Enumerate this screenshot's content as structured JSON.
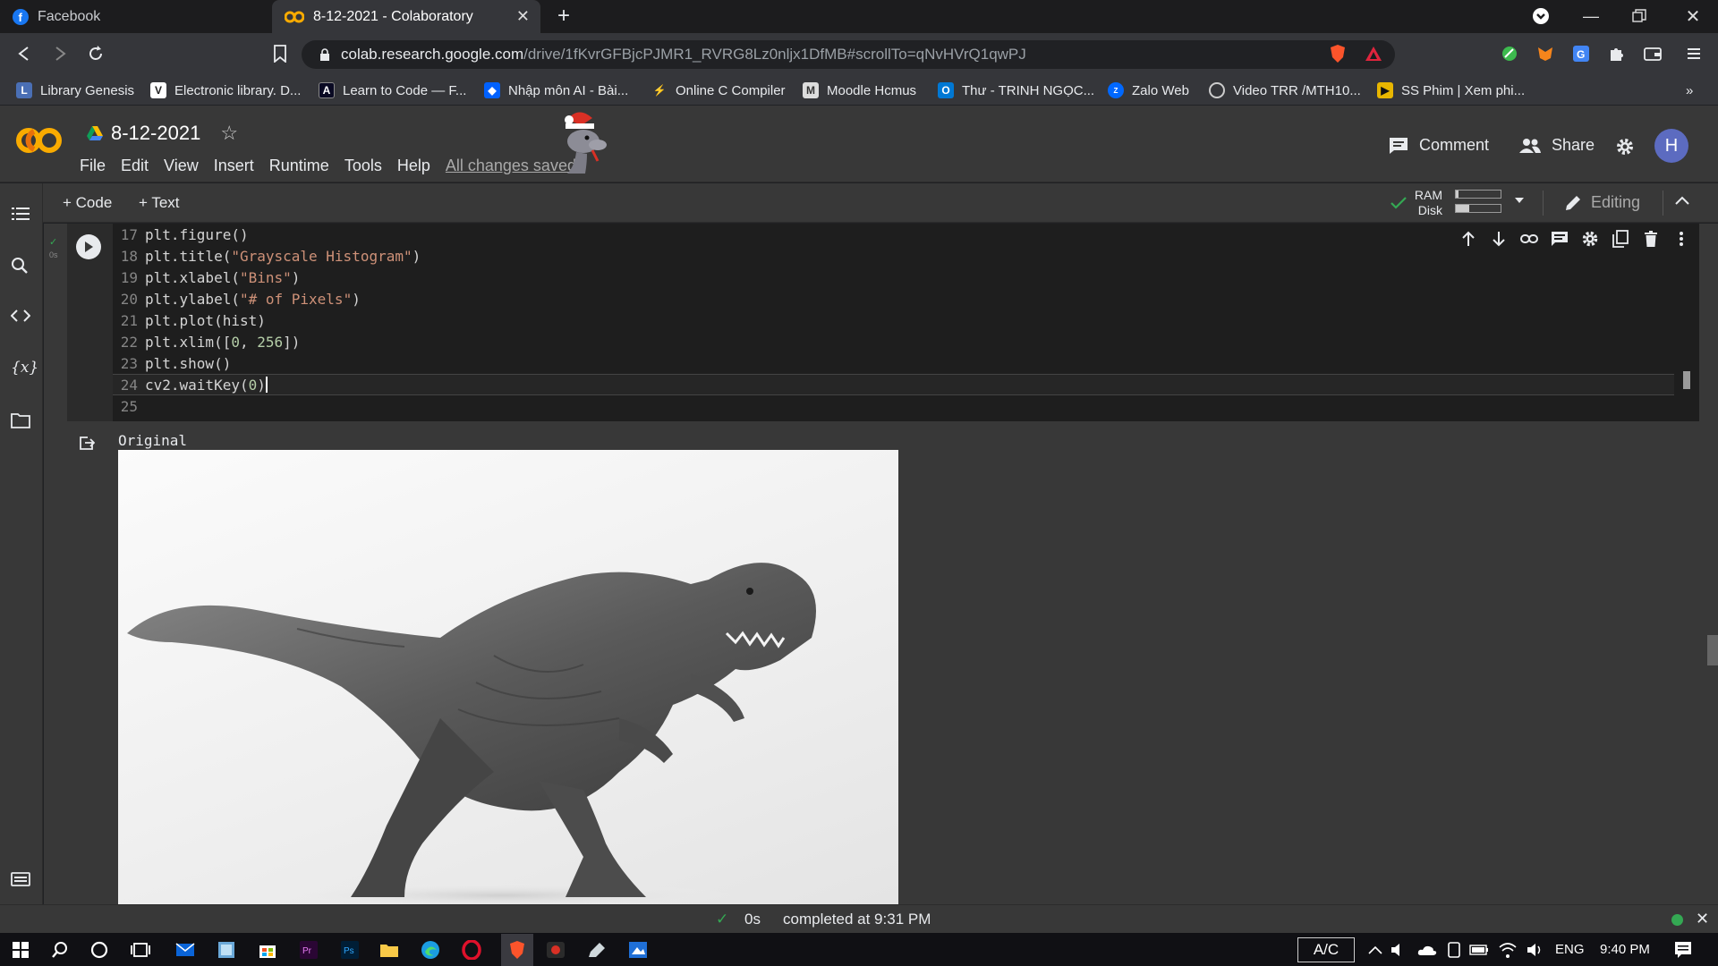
{
  "browser": {
    "tabs": [
      {
        "title": "Facebook",
        "active": false
      },
      {
        "title": "8-12-2021 - Colaboratory",
        "active": true
      }
    ],
    "url_host": "colab.research.google.com",
    "url_path": "/drive/1fKvrGFBjcPJMR1_RVRG8Lz0nljx1DfMB#scrollTo=qNvHVrQ1qwPJ",
    "bookmarks": [
      "Library Genesis",
      "Electronic library. D...",
      "Learn to Code — F...",
      "Nhập môn AI - Bài...",
      "Online C Compiler",
      "Moodle Hcmus",
      "Thư - TRINH NGỌC...",
      "Zalo Web",
      "Video TRR /MTH10...",
      "SS Phim | Xem phi..."
    ],
    "bookmarks_more": "»"
  },
  "colab": {
    "logo": "CO",
    "notebook_title": "8-12-2021",
    "menu": [
      "File",
      "Edit",
      "View",
      "Insert",
      "Runtime",
      "Tools",
      "Help"
    ],
    "save_status": "All changes saved",
    "comment_label": "Comment",
    "share_label": "Share",
    "avatar_letter": "H",
    "add_code": "+ Code",
    "add_text": "+ Text",
    "ram_label": "RAM",
    "disk_label": "Disk",
    "editing_label": "Editing",
    "ram_usage": 0.05,
    "disk_usage": 0.3
  },
  "cell": {
    "exec_time": "0s",
    "lines": [
      {
        "n": "17",
        "parts": [
          [
            "fn",
            "plt.figure()"
          ]
        ]
      },
      {
        "n": "18",
        "parts": [
          [
            "fn",
            "plt.title("
          ],
          [
            "str",
            "\"Grayscale Histogram\""
          ],
          [
            "fn",
            ")"
          ]
        ]
      },
      {
        "n": "19",
        "parts": [
          [
            "fn",
            "plt.xlabel("
          ],
          [
            "str",
            "\"Bins\""
          ],
          [
            "fn",
            ")"
          ]
        ]
      },
      {
        "n": "20",
        "parts": [
          [
            "fn",
            "plt.ylabel("
          ],
          [
            "str",
            "\"# of Pixels\""
          ],
          [
            "fn",
            ")"
          ]
        ]
      },
      {
        "n": "21",
        "parts": [
          [
            "fn",
            "plt.plot(hist)"
          ]
        ]
      },
      {
        "n": "22",
        "parts": [
          [
            "fn",
            "plt.xlim(["
          ],
          [
            "num",
            "0"
          ],
          [
            "fn",
            ", "
          ],
          [
            "num",
            "256"
          ],
          [
            "fn",
            "])"
          ]
        ]
      },
      {
        "n": "23",
        "parts": [
          [
            "fn",
            "plt.show()"
          ]
        ]
      },
      {
        "n": "24",
        "parts": [
          [
            "fn",
            "cv2.waitKey("
          ],
          [
            "num",
            "0"
          ],
          [
            "fn",
            ")"
          ]
        ]
      },
      {
        "n": "25",
        "parts": []
      }
    ],
    "output_label": "Original"
  },
  "status": {
    "time": "0s",
    "message": "completed at 9:31 PM"
  },
  "taskbar": {
    "ac_label": "A/C",
    "lang": "ENG",
    "clock": "9:40 PM"
  },
  "colors": {
    "colab_orange": "#f9ab00",
    "avatar": "#5c6bc0",
    "check_green": "#34a853"
  }
}
